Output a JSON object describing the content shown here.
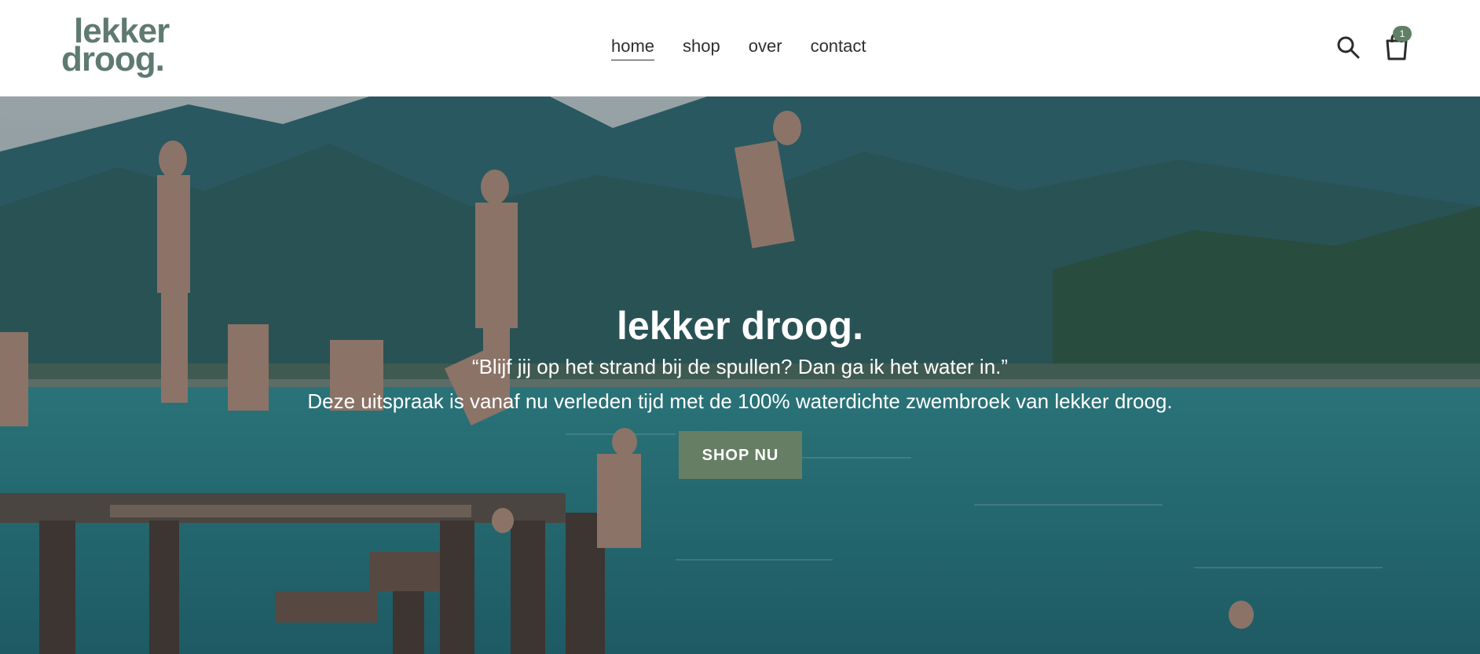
{
  "brand": {
    "line1": "lekker",
    "line2": "droog."
  },
  "nav": [
    {
      "label": "home",
      "active": true
    },
    {
      "label": "shop",
      "active": false
    },
    {
      "label": "over",
      "active": false
    },
    {
      "label": "contact",
      "active": false
    }
  ],
  "header_icons": {
    "search": "search-icon",
    "cart": "shopping-bag-icon",
    "cart_count": "1"
  },
  "hero": {
    "title": "lekker droog.",
    "quote": "“Blijf jij op het strand bij de spullen? Dan ga ik het water in.”",
    "subtitle": "Deze uitspraak is vanaf nu verleden tijd met de 100% waterdichte zwembroek van lekker droog.",
    "cta_label": "SHOP NU"
  },
  "colors": {
    "brand": "#5f7a70",
    "cta": "#667f64",
    "badge": "#5f7f66",
    "sea": "#2f8f95"
  }
}
